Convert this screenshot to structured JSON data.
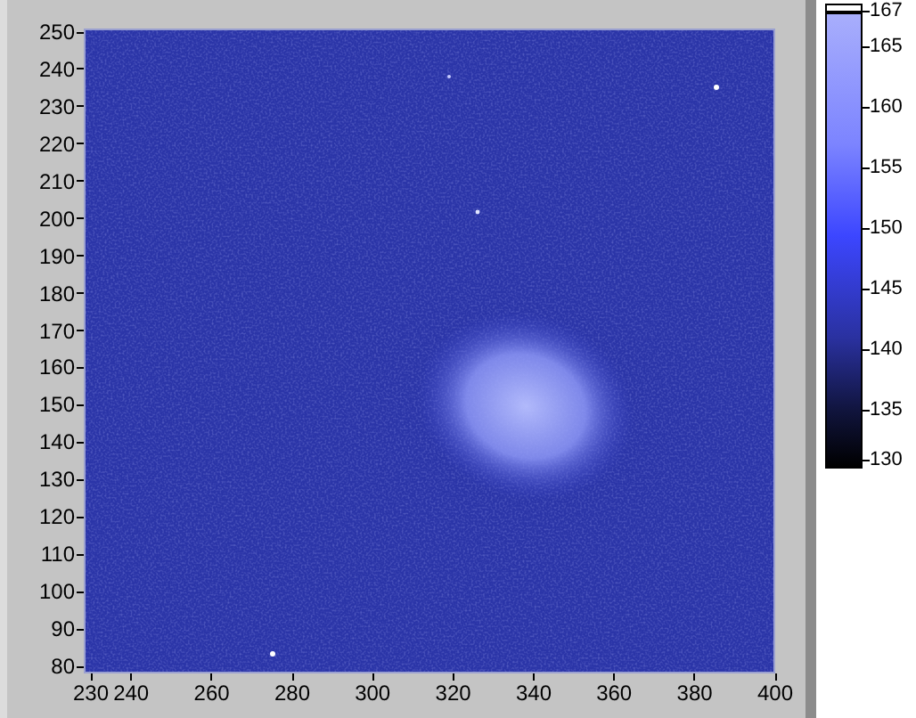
{
  "graph": {
    "y_axis": {
      "ticks": [
        "250",
        "240",
        "230",
        "220",
        "210",
        "200",
        "190",
        "180",
        "170",
        "160",
        "150",
        "140",
        "130",
        "120",
        "110",
        "100",
        "90",
        "80"
      ]
    },
    "x_axis": {
      "ticks": [
        "230",
        "240",
        "260",
        "280",
        "300",
        "320",
        "340",
        "360",
        "380",
        "400"
      ]
    }
  },
  "color_scale": {
    "labels": [
      "167",
      "165",
      "160",
      "155",
      "150",
      "145",
      "140",
      "135",
      "130"
    ]
  }
}
